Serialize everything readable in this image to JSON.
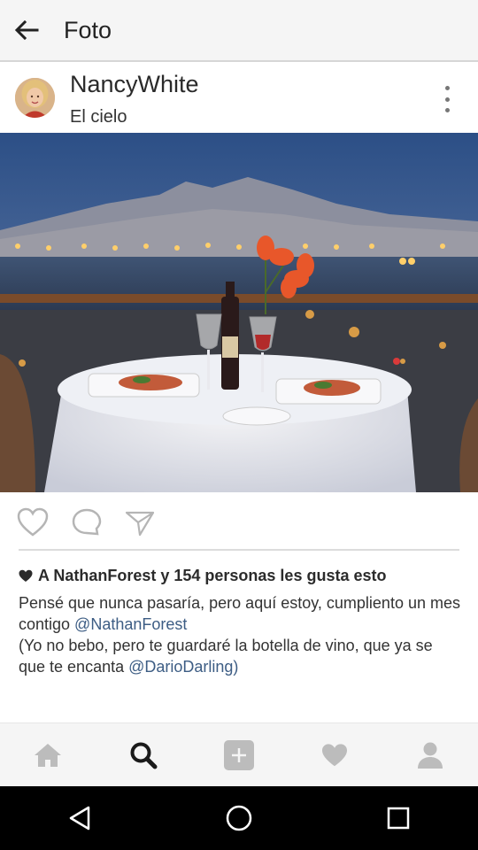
{
  "appbar": {
    "title": "Foto"
  },
  "post": {
    "username": "NancyWhite",
    "location": "El cielo"
  },
  "likes": {
    "text": "A NathanForest y 154 personas les gusta esto"
  },
  "caption": {
    "line1": "Pensé que nunca pasaría, pero aquí estoy, cumpliento un mes contigo ",
    "mention1": "@NathanForest",
    "line2": "(Yo no bebo, pero te guardaré la botella de vino, que ya se que te encanta ",
    "mention2": "@DarioDarling",
    "line2_end": ")"
  },
  "icons": {
    "back": "arrow-back-icon",
    "more": "more-vertical-icon",
    "like": "heart-outline-icon",
    "comment": "comment-bubble-icon",
    "share": "send-icon",
    "nav": [
      "home-icon",
      "search-icon",
      "add-post-icon",
      "activity-heart-icon",
      "profile-icon"
    ],
    "system": [
      "back-triangle-icon",
      "home-circle-icon",
      "recents-square-icon"
    ]
  },
  "colors": {
    "mention": "#3d5d84",
    "nav_active": "#1a1a1a",
    "nav_inactive": "#bcbcbc",
    "appbar_bg": "#f5f5f5"
  }
}
